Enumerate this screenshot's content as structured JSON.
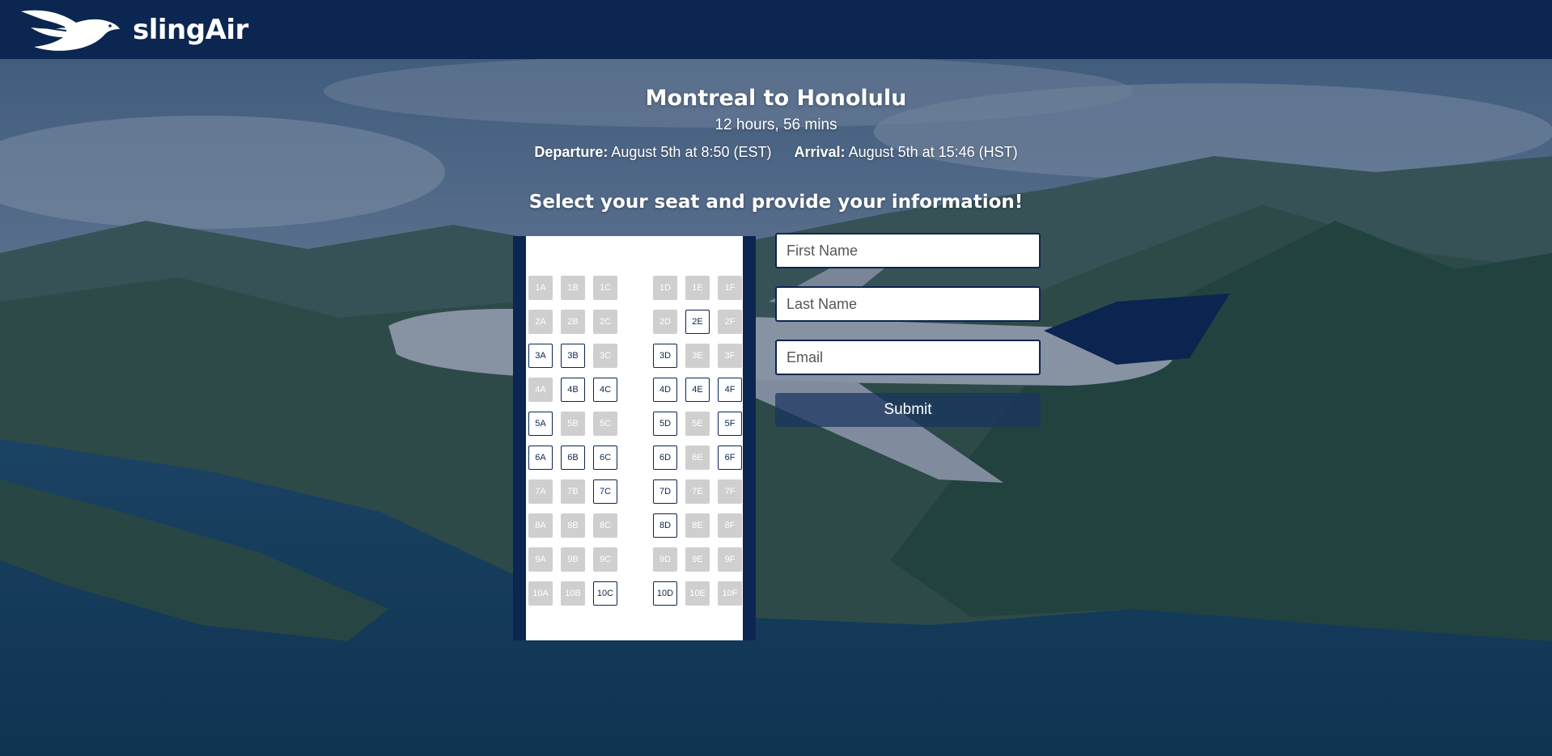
{
  "header": {
    "brand": "slingAir",
    "logo_icon": "eagle-logo-icon"
  },
  "flight": {
    "route": "Montreal to Honolulu",
    "duration": "12 hours, 56 mins",
    "departure_label": "Departure:",
    "departure_value": "August 5th at 8:50 (EST)",
    "arrival_label": "Arrival:",
    "arrival_value": "August 5th at 15:46 (HST)"
  },
  "prompt": "Select your seat and provide your information!",
  "seats": {
    "columns": [
      "A",
      "B",
      "C",
      "D",
      "E",
      "F"
    ],
    "rows": [
      1,
      2,
      3,
      4,
      5,
      6,
      7,
      8,
      9,
      10
    ],
    "available": [
      "2E",
      "3A",
      "3B",
      "3D",
      "4B",
      "4C",
      "4D",
      "4E",
      "4F",
      "5A",
      "5D",
      "5F",
      "6A",
      "6B",
      "6C",
      "6D",
      "6F",
      "7C",
      "7D",
      "8D",
      "10C",
      "10D"
    ]
  },
  "form": {
    "first_name_placeholder": "First Name",
    "last_name_placeholder": "Last Name",
    "email_placeholder": "Email",
    "submit_label": "Submit"
  },
  "colors": {
    "navy": "#0b2650",
    "seat_taken": "#cfcfcf",
    "white": "#ffffff"
  }
}
